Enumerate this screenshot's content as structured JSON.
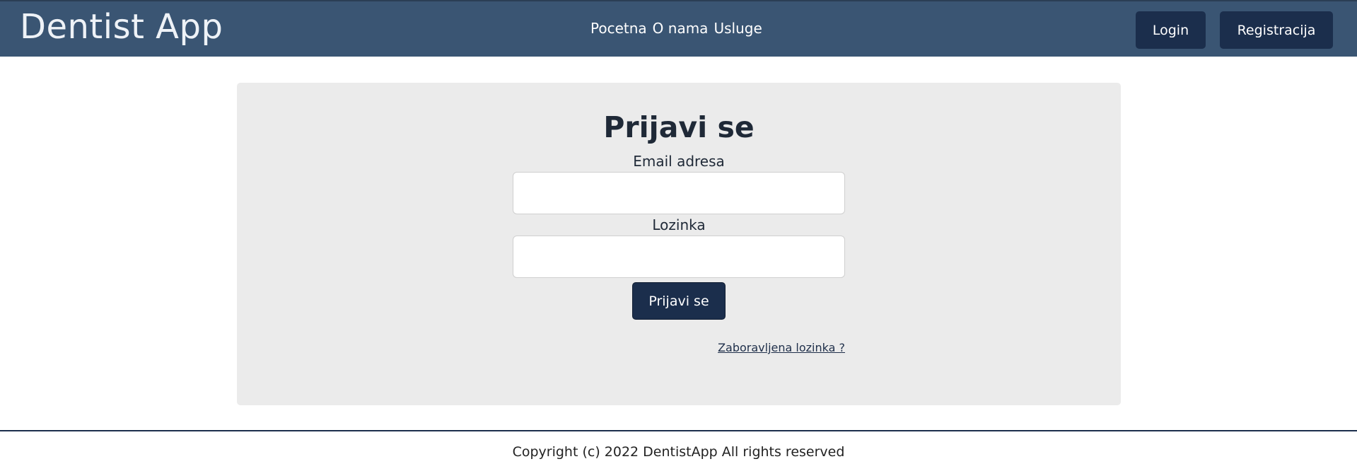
{
  "header": {
    "brand": "Dentist App",
    "nav": [
      "Pocetna",
      "O nama",
      "Usluge"
    ],
    "login_label": "Login",
    "register_label": "Registracija"
  },
  "login_form": {
    "title": "Prijavi se",
    "email_label": "Email adresa",
    "email_value": "",
    "password_label": "Lozinka",
    "password_value": "",
    "submit_label": "Prijavi se",
    "forgot_link": "Zaboravljena lozinka ?"
  },
  "footer": {
    "copyright": "Copyright (c) 2022 DentistApp All rights reserved"
  },
  "colors": {
    "navbar": "#3a5573",
    "button": "#1b2e4c",
    "card": "#ebebeb"
  }
}
